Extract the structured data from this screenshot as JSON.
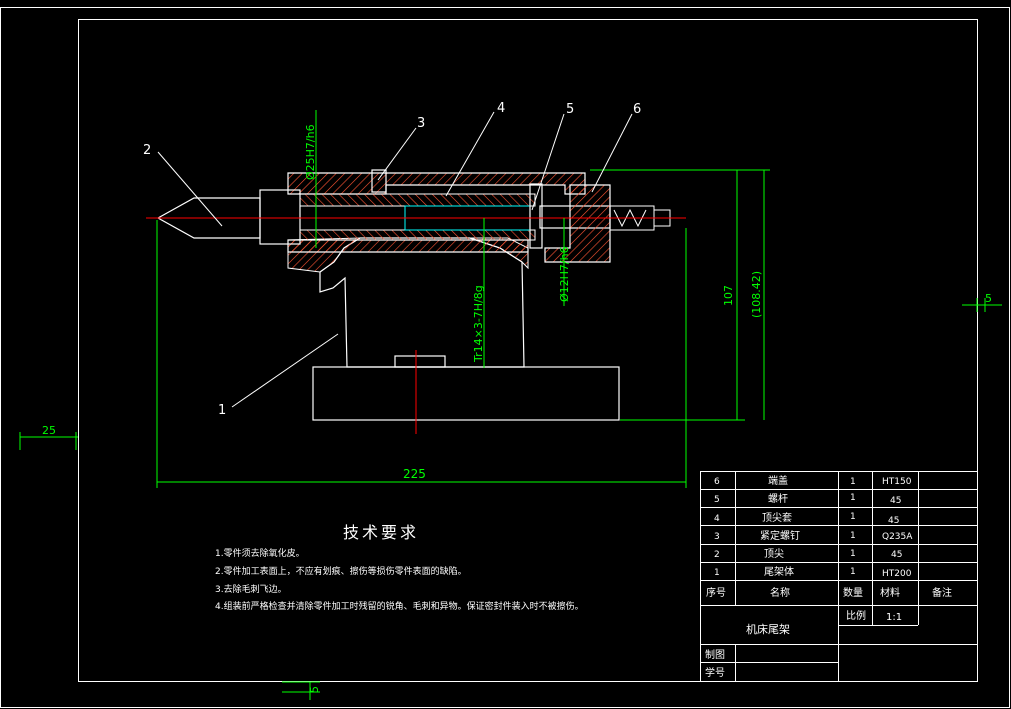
{
  "colors": {
    "background": "#000000",
    "outline": "#ffffff",
    "dimension": "#00ff00",
    "centerline": "#ff0000",
    "hatch": "#ff5533",
    "hidden": "#00ffff"
  },
  "callouts": [
    "1",
    "2",
    "3",
    "4",
    "5",
    "6"
  ],
  "dimensions": {
    "fit_sleeve": "Ø25H7/h6",
    "thread": "Tr14×3-7H/8g",
    "fit_screw": "Ø12H7/h6",
    "overall_width": "225",
    "height": "107",
    "height_ref": "(108.42)",
    "margin_left": "25",
    "margin_right": "5",
    "margin_bottom": "5"
  },
  "tech_requirements": {
    "title": "技术要求",
    "items": [
      "1.零件须去除氧化皮。",
      "2.零件加工表面上，不应有划痕、擦伤等损伤零件表面的缺陷。",
      "3.去除毛刺飞边。",
      "4.组装前严格检查并清除零件加工时残留的锐角、毛刺和异物。保证密封件装入时不被擦伤。"
    ]
  },
  "bom": {
    "rows": [
      {
        "no": "6",
        "name": "端盖",
        "qty": "1",
        "material": "HT150"
      },
      {
        "no": "5",
        "name": "螺杆",
        "qty": "1",
        "material": "45"
      },
      {
        "no": "4",
        "name": "顶尖套",
        "qty": "1",
        "material": "45"
      },
      {
        "no": "3",
        "name": "紧定螺钉",
        "qty": "1",
        "material": "Q235A"
      },
      {
        "no": "2",
        "name": "顶尖",
        "qty": "1",
        "material": "45"
      },
      {
        "no": "1",
        "name": "尾架体",
        "qty": "1",
        "material": "HT200"
      }
    ],
    "header": {
      "no": "序号",
      "name": "名称",
      "qty": "数量",
      "material": "材料",
      "remark": "备注"
    },
    "title": "机床尾架",
    "scale_label": "比例",
    "scale_value": "1:1",
    "drawn_label": "制图",
    "student_label": "学号"
  }
}
